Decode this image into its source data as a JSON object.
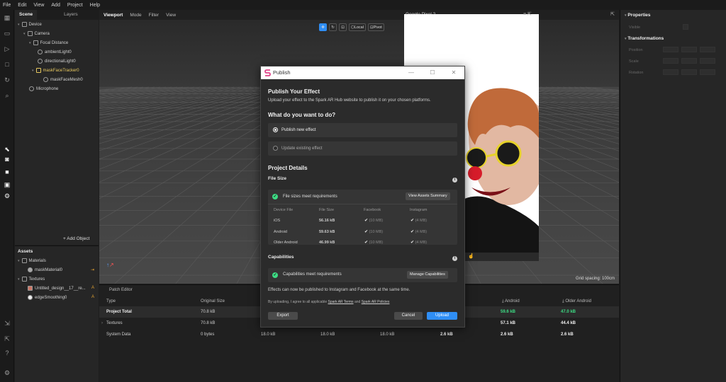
{
  "menu": [
    "File",
    "Edit",
    "View",
    "Add",
    "Project",
    "Help"
  ],
  "scene": {
    "tabs": [
      "Scene",
      "Layers"
    ],
    "items": [
      {
        "label": "Device"
      },
      {
        "label": "Camera"
      },
      {
        "label": "Focal Distance"
      },
      {
        "label": "ambientLight0"
      },
      {
        "label": "directionalLight0"
      },
      {
        "label": "maskFaceTracker0"
      },
      {
        "label": "maskFaceMesh0"
      },
      {
        "label": "Microphone"
      }
    ],
    "add_object": "+ Add Object"
  },
  "assets": {
    "title": "Assets",
    "materials_label": "Materials",
    "material_item": "maskMaterial0",
    "textures_label": "Textures",
    "texture_items": [
      "Untitled_design__17__re...",
      "edgeSmoothing0"
    ],
    "texture_tags": [
      "A",
      "A"
    ]
  },
  "viewport": {
    "tabs": [
      "Viewport",
      "Mode",
      "Filter",
      "View"
    ],
    "device": "Google Pixel 2",
    "local_label": "Local",
    "pivot_label": "Pivot",
    "grid_spacing": "Grid spacing: 100cm"
  },
  "properties": {
    "title": "Properties",
    "visible_label": "Visible",
    "transformations_title": "Transformations",
    "rows": [
      "Position",
      "Scale",
      "Rotation"
    ]
  },
  "patch_editor": {
    "tab": "Patch Editor",
    "headers": [
      "Type",
      "Original Size",
      "Android",
      "Older Android"
    ],
    "rows": [
      {
        "type": "Project Total",
        "original": "70.8 kB",
        "android": "59.6 kB",
        "older": "47.0 kB"
      },
      {
        "type": "Textures",
        "original": "70.8 kB",
        "android": "57.1 kB",
        "older": "44.4 kB"
      },
      {
        "type": "System Data",
        "original": "0 bytes",
        "c3": "18.0 kB",
        "c4": "18.0 kB",
        "c5": "18.0 kB",
        "c6": "2.6 kB",
        "android": "2.6 kB",
        "older": "2.6 kB"
      }
    ]
  },
  "dialog": {
    "title": "Publish",
    "heading": "Publish Your Effect",
    "subheading": "Upload your effect to the Spark AR Hub website to publish it on your chosen platforms.",
    "question": "What do you want to do?",
    "option_new": "Publish new effect",
    "option_update": "Update existing effect",
    "details_title": "Project Details",
    "file_size_title": "File Size",
    "file_size_status": "File sizes meet requirements",
    "view_assets": "View Assets Summary",
    "table_headers": [
      "Device File",
      "File Size",
      "Facebook",
      "Instagram"
    ],
    "table_rows": [
      {
        "device": "iOS",
        "size": "56.16 kB",
        "fb": "(10 MB)",
        "ig": "(4 MB)"
      },
      {
        "device": "Android",
        "size": "59.63 kB",
        "fb": "(10 MB)",
        "ig": "(4 MB)"
      },
      {
        "device": "Older Android",
        "size": "46.99 kB",
        "fb": "(10 MB)",
        "ig": "(4 MB)"
      }
    ],
    "capabilities_title": "Capabilities",
    "capabilities_status": "Capabilities meet requirements",
    "manage_capabilities": "Manage Capabilities",
    "publish_note": "Effects can now be published to Instagram and Facebook at the same time.",
    "agree_prefix": "By uploading, I agree to all applicable",
    "terms_link": "Spark AR Terms",
    "and_text": "and",
    "policies_link": "Spark AR Policies",
    "export_label": "Export",
    "cancel_label": "Cancel",
    "upload_label": "Upload",
    "accent": "#2f8ef5",
    "ok_color": "#3ddc84"
  }
}
